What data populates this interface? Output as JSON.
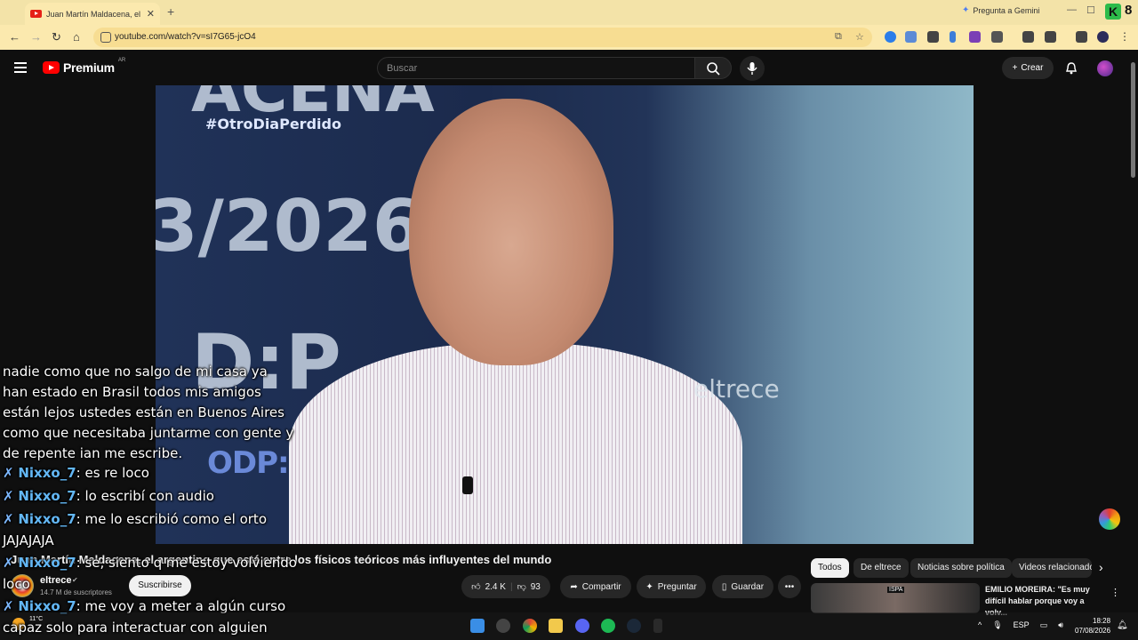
{
  "browser": {
    "tab_title": "Juan Martín Maldacena, el argentino",
    "new_tab_symbol": "+",
    "gemini_label": "Pregunta a Gemini",
    "k_badge": "K",
    "k_count": "8",
    "url": "youtube.com/watch?v=sI7G65-jcO4"
  },
  "youtube": {
    "logo_text": "Premium",
    "country_code": "AR",
    "search_placeholder": "Buscar",
    "create_label": "Crear"
  },
  "video": {
    "hashtag": "#OtroDiaPerdido",
    "bg_date": "3/2026",
    "bg_top": "ACENA",
    "bg_letters": "D:P",
    "watermark": "eltrece",
    "odp_logo": "ODP:"
  },
  "watch": {
    "title": "Juan Martín Maldacena, el argentino que está entre los físicos teóricos más influyentes del mundo",
    "channel": "eltrece",
    "subscribers": "14.7 M de suscriptores",
    "subscribe_label": "Suscribirse",
    "likes": "2.4 K",
    "dislikes": "93",
    "share_label": "Compartir",
    "ask_label": "Preguntar",
    "save_label": "Guardar"
  },
  "chips": [
    "Todos",
    "De eltrece",
    "Noticias sobre política",
    "Videos relacionados"
  ],
  "recommendation": {
    "title": "EMILIO MOREIRA: \"Es muy difícil hablar porque voy a volv...",
    "thumb_tag": "ISPA"
  },
  "chat": {
    "paragraph": "nadie como que no salgo de mi casa ya han estado en Brasil todos mis amigos están lejos ustedes están en Buenos Aires como que necesitaba juntarme con gente y de repente ian me escribe.",
    "messages": [
      {
        "user": "Nixxo_7",
        "text": ": es re loco"
      },
      {
        "user": "Nixxo_7",
        "text": ": lo escribí con audio"
      },
      {
        "user": "Nixxo_7",
        "text": ": me lo escribió como el orto"
      },
      {
        "user": "",
        "text": "JAJAJAJA"
      },
      {
        "user": "Nixxo_7",
        "text": ": se, siento q me estoy volviendo"
      },
      {
        "user": "",
        "text": "loco"
      },
      {
        "user": "Nixxo_7",
        "text": ": me voy a meter a algún curso"
      },
      {
        "user": "",
        "text": "capaz solo para interactuar con alguien"
      }
    ]
  },
  "taskbar": {
    "temperature": "11°C",
    "language": "ESP",
    "time": "18:28",
    "date": "07/08/2026"
  }
}
